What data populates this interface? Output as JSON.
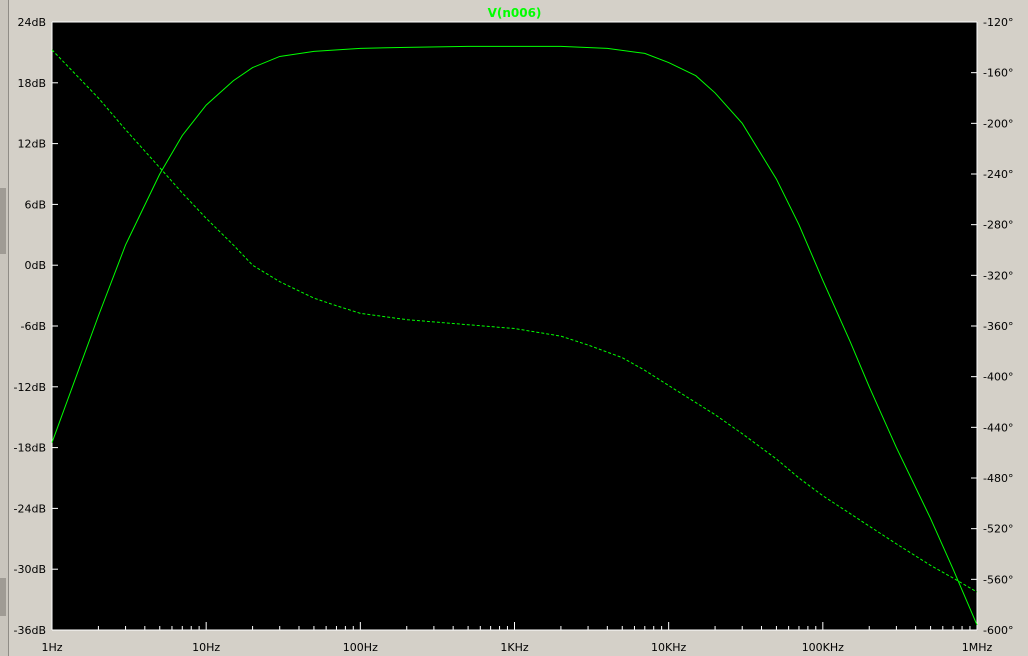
{
  "chart_data": {
    "type": "line",
    "title": "V(n006)",
    "xscale": "log",
    "x_ticks": [
      "1Hz",
      "10Hz",
      "100Hz",
      "1KHz",
      "10KHz",
      "100KHz",
      "1MHz"
    ],
    "y_left_ticks": [
      "24dB",
      "18dB",
      "12dB",
      "6dB",
      "0dB",
      "-6dB",
      "-12dB",
      "-18dB",
      "-24dB",
      "-30dB",
      "-36dB"
    ],
    "y_right_ticks": [
      "-120°",
      "-160°",
      "-200°",
      "-240°",
      "-280°",
      "-320°",
      "-360°",
      "-400°",
      "-440°",
      "-480°",
      "-520°",
      "-560°",
      "-600°"
    ],
    "xlim_hz": [
      1,
      1000000
    ],
    "ylim_left_db": [
      -36,
      24
    ],
    "ylim_right_deg": [
      -600,
      -120
    ],
    "grid": false,
    "series": [
      {
        "axis": "left",
        "style": "solid",
        "color": "#00ff00",
        "points": [
          [
            1,
            -17.5
          ],
          [
            2,
            -5
          ],
          [
            3,
            2
          ],
          [
            5,
            9
          ],
          [
            7,
            12.8
          ],
          [
            10,
            15.8
          ],
          [
            15,
            18.2
          ],
          [
            20,
            19.5
          ],
          [
            30,
            20.6
          ],
          [
            50,
            21.1
          ],
          [
            100,
            21.4
          ],
          [
            200,
            21.5
          ],
          [
            500,
            21.6
          ],
          [
            1000,
            21.6
          ],
          [
            2000,
            21.6
          ],
          [
            4000,
            21.4
          ],
          [
            7000,
            20.9
          ],
          [
            10000,
            20.0
          ],
          [
            15000,
            18.7
          ],
          [
            20000,
            17.0
          ],
          [
            30000,
            14.0
          ],
          [
            50000,
            8.5
          ],
          [
            70000,
            4.0
          ],
          [
            100000,
            -1.5
          ],
          [
            150000,
            -7.5
          ],
          [
            200000,
            -12.0
          ],
          [
            300000,
            -18.0
          ],
          [
            500000,
            -25.0
          ],
          [
            700000,
            -30.0
          ],
          [
            1000000,
            -35.5
          ]
        ]
      },
      {
        "axis": "right",
        "style": "dashed",
        "color": "#00ff00",
        "points": [
          [
            1,
            -142
          ],
          [
            2,
            -180
          ],
          [
            3,
            -205
          ],
          [
            5,
            -235
          ],
          [
            7,
            -255
          ],
          [
            10,
            -275
          ],
          [
            15,
            -296
          ],
          [
            20,
            -312
          ],
          [
            30,
            -325
          ],
          [
            50,
            -338
          ],
          [
            70,
            -344
          ],
          [
            100,
            -350
          ],
          [
            200,
            -355
          ],
          [
            500,
            -359
          ],
          [
            1000,
            -362
          ],
          [
            2000,
            -368
          ],
          [
            3000,
            -375
          ],
          [
            5000,
            -385
          ],
          [
            7000,
            -395
          ],
          [
            10000,
            -407
          ],
          [
            20000,
            -430
          ],
          [
            30000,
            -445
          ],
          [
            50000,
            -465
          ],
          [
            70000,
            -480
          ],
          [
            100000,
            -494
          ],
          [
            200000,
            -518
          ],
          [
            300000,
            -532
          ],
          [
            500000,
            -549
          ],
          [
            700000,
            -559
          ],
          [
            1000000,
            -570
          ]
        ]
      }
    ]
  }
}
